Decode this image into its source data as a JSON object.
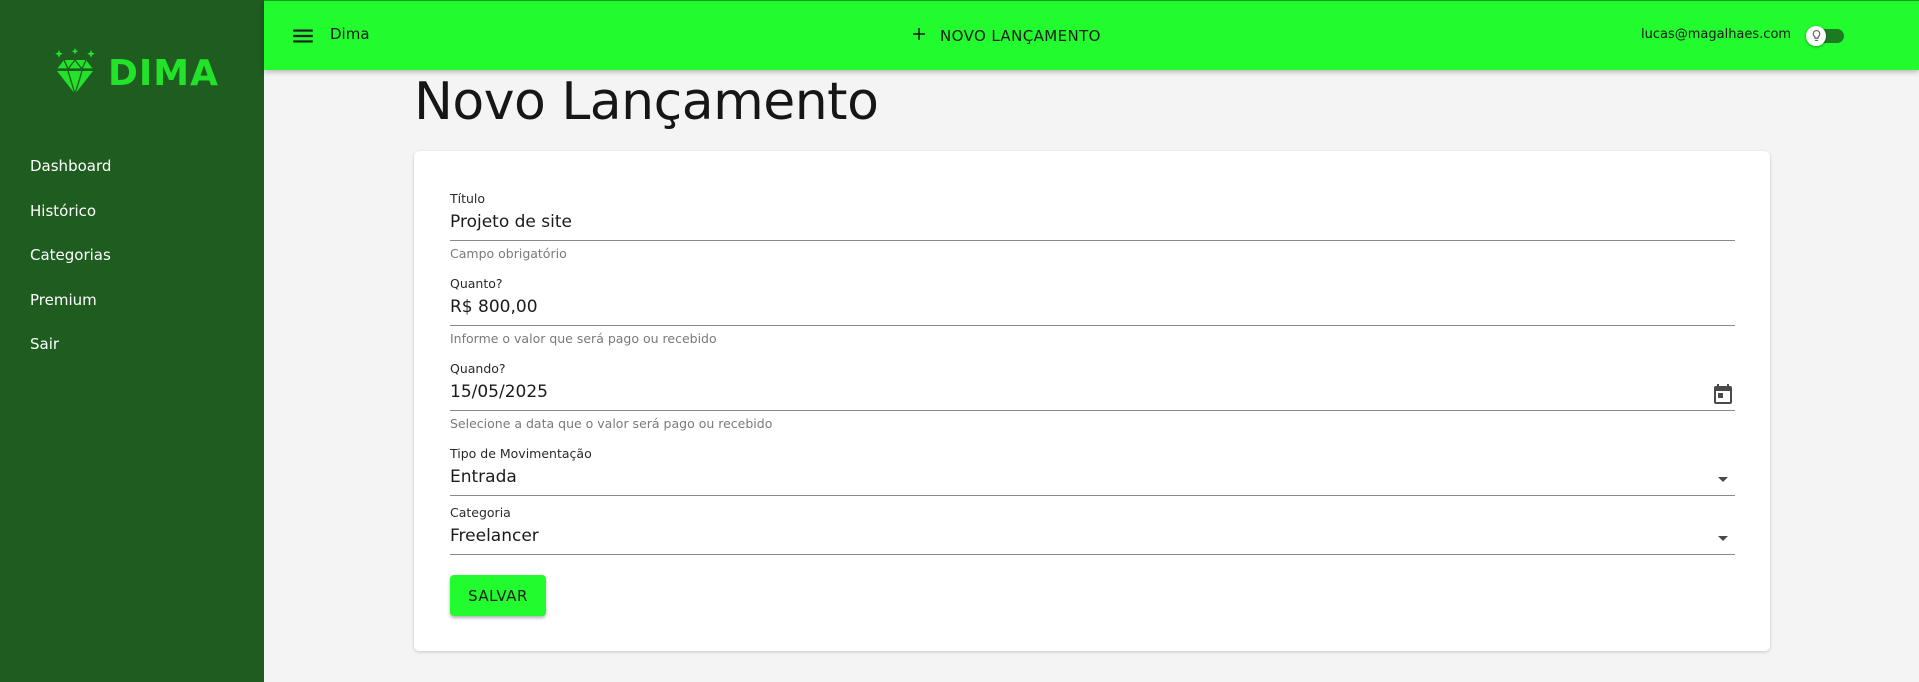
{
  "brand": {
    "name": "DIMA",
    "color": "#22e22a"
  },
  "sidebar": {
    "background": "#1e5c20",
    "items": [
      {
        "label": "Dashboard"
      },
      {
        "label": "Histórico"
      },
      {
        "label": "Categorias"
      },
      {
        "label": "Premium"
      },
      {
        "label": "Sair"
      }
    ]
  },
  "topbar": {
    "background": "#22fc2e",
    "app_title": "Dima",
    "new_entry_label": "NOVO LANÇAMENTO",
    "user_email": "lucas@magalhaes.com",
    "icons": [
      "menu-icon",
      "plus-icon",
      "lightbulb-icon"
    ],
    "theme_toggle_on": true
  },
  "page": {
    "title": "Novo Lançamento"
  },
  "form": {
    "title": {
      "label": "Título",
      "value": "Projeto de site",
      "helper": "Campo obrigatório"
    },
    "amount": {
      "label": "Quanto?",
      "value": "R$ 800,00",
      "helper": "Informe o valor que será pago ou recebido"
    },
    "date": {
      "label": "Quando?",
      "value": "15/05/2025",
      "helper": "Selecione a data que o valor será pago ou recebido",
      "icon": "calendar-icon"
    },
    "type": {
      "label": "Tipo de Movimentação",
      "value": "Entrada",
      "icon": "dropdown-arrow-icon"
    },
    "category": {
      "label": "Categoria",
      "value": "Freelancer",
      "icon": "dropdown-arrow-icon"
    },
    "save_label": "SALVAR"
  }
}
